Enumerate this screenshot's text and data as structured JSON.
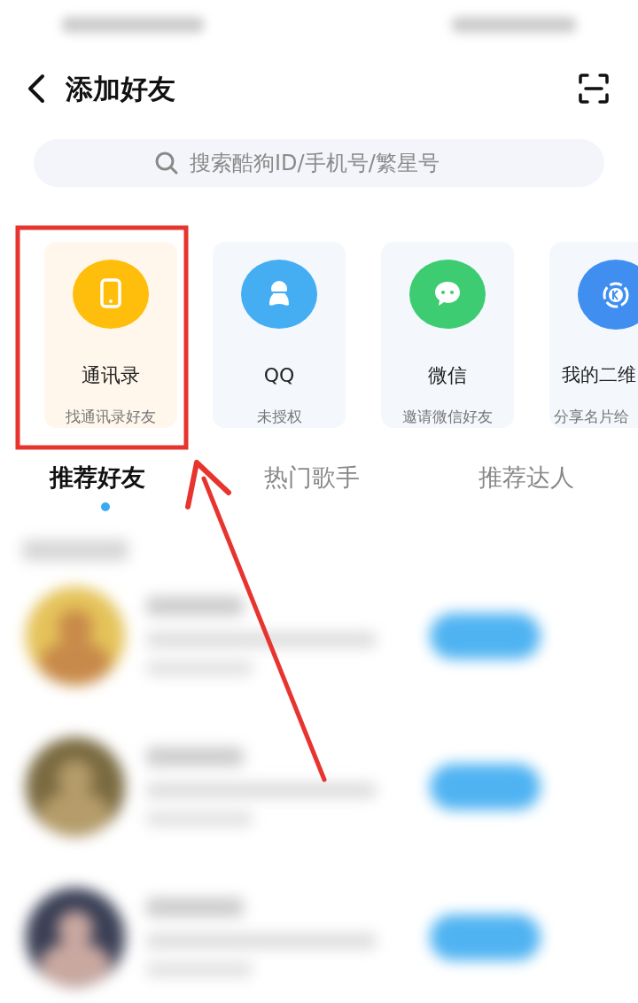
{
  "header": {
    "title": "添加好友"
  },
  "search": {
    "placeholder": "搜索酷狗ID/手机号/繁星号"
  },
  "entries": [
    {
      "kind": "contacts",
      "title": "通讯录",
      "subtitle": "找通讯录好友",
      "color": "#ffbe0b",
      "highlighted": true
    },
    {
      "kind": "qq",
      "title": "QQ",
      "subtitle": "未授权",
      "color": "#45aef2",
      "highlighted": false
    },
    {
      "kind": "wechat",
      "title": "微信",
      "subtitle": "邀请微信好友",
      "color": "#3dcc72",
      "highlighted": false
    },
    {
      "kind": "qrcode",
      "title": "我的二维",
      "subtitle": "分享名片给",
      "color": "#3f8ef0",
      "highlighted": false
    }
  ],
  "tabs": [
    {
      "label": "推荐好友",
      "selected": true
    },
    {
      "label": "热门歌手",
      "selected": false
    },
    {
      "label": "推荐达人",
      "selected": false
    }
  ]
}
